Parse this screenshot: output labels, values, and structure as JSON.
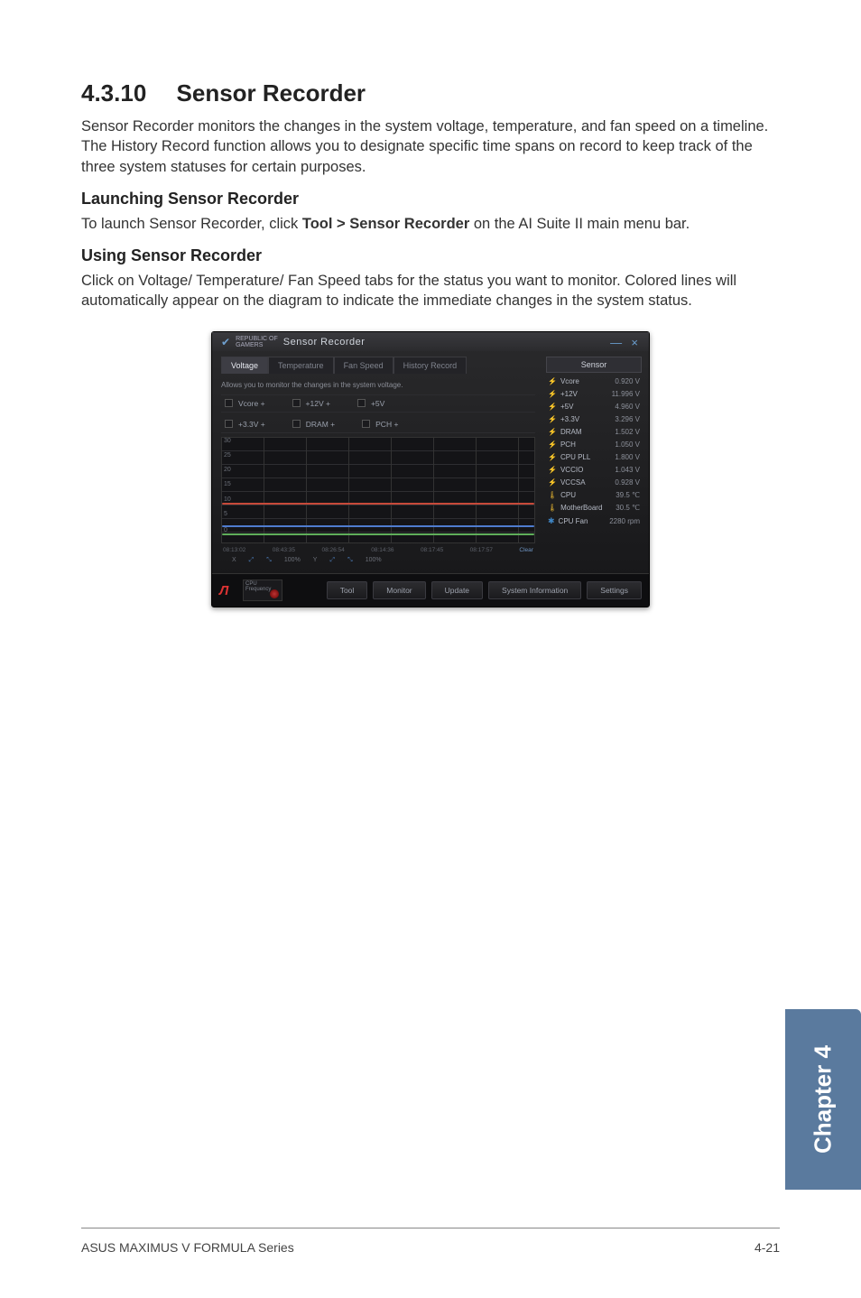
{
  "doc": {
    "heading_number": "4.3.10",
    "heading_title": "Sensor Recorder",
    "intro": "Sensor Recorder monitors the changes in the system voltage, temperature, and fan speed on a timeline. The History Record function allows you to designate specific time spans on record to keep track of the three system statuses for certain purposes.",
    "launch_heading": "Launching Sensor Recorder",
    "launch_text_1": "To launch Sensor Recorder, click ",
    "launch_text_bold": "Tool > Sensor Recorder",
    "launch_text_2": " on the AI Suite II main menu bar.",
    "using_heading": "Using Sensor Recorder",
    "using_text": "Click on Voltage/ Temperature/ Fan Speed tabs for the status you want to monitor. Colored lines will automatically appear on the diagram to indicate the immediate changes in the system status.",
    "side_tab": "Chapter 4",
    "footer_left": "ASUS MAXIMUS V FORMULA Series",
    "footer_right": "4-21"
  },
  "app": {
    "brand_top": "REPUBLIC OF",
    "brand_bottom": "GAMERS",
    "title": "Sensor Recorder",
    "window_buttons": {
      "min": "—",
      "close": "×"
    },
    "tabs": [
      "Voltage",
      "Temperature",
      "Fan Speed",
      "History Record"
    ],
    "active_tab_index": 0,
    "hint": "Allows you to monitor the changes in the system voltage.",
    "legend_rows": [
      [
        "Vcore +",
        "+12V +",
        "+5V"
      ],
      [
        "+3.3V +",
        "DRAM +",
        "PCH +"
      ]
    ],
    "yticks": [
      "30",
      "25",
      "20",
      "15",
      "10",
      "5",
      "0"
    ],
    "xticks": [
      "08:13:02",
      "08:43:35",
      "08:26:54",
      "08:14:36",
      "08:17:45",
      "08:17:57"
    ],
    "zoom": {
      "x_label": "X",
      "x_zoom": "100%",
      "y_label": "Y",
      "y_zoom": "100%"
    },
    "clear_label": "Clear",
    "sensor_panel_title": "Sensor",
    "sensors": [
      {
        "icon": "bolt",
        "name": "Vcore",
        "value": "0.920 V"
      },
      {
        "icon": "bolt",
        "name": "+12V",
        "value": "11.996 V"
      },
      {
        "icon": "bolt",
        "name": "+5V",
        "value": "4.960 V"
      },
      {
        "icon": "bolt",
        "name": "+3.3V",
        "value": "3.296 V"
      },
      {
        "icon": "bolt",
        "name": "DRAM",
        "value": "1.502 V"
      },
      {
        "icon": "bolt",
        "name": "PCH",
        "value": "1.050 V"
      },
      {
        "icon": "bolt",
        "name": "CPU PLL",
        "value": "1.800 V"
      },
      {
        "icon": "bolt",
        "name": "VCCIO",
        "value": "1.043 V"
      },
      {
        "icon": "bolt",
        "name": "VCCSA",
        "value": "0.928 V"
      },
      {
        "icon": "therm",
        "name": "CPU",
        "value": "39.5 ℃"
      },
      {
        "icon": "therm",
        "name": "MotherBoard",
        "value": "30.5 ℃"
      },
      {
        "icon": "fan",
        "name": "CPU Fan",
        "value": "2280 rpm"
      }
    ],
    "bottom_buttons": [
      "Tool",
      "Monitor",
      "Update",
      "System Information",
      "Settings"
    ],
    "thumb_label": "CPU Frequency"
  }
}
